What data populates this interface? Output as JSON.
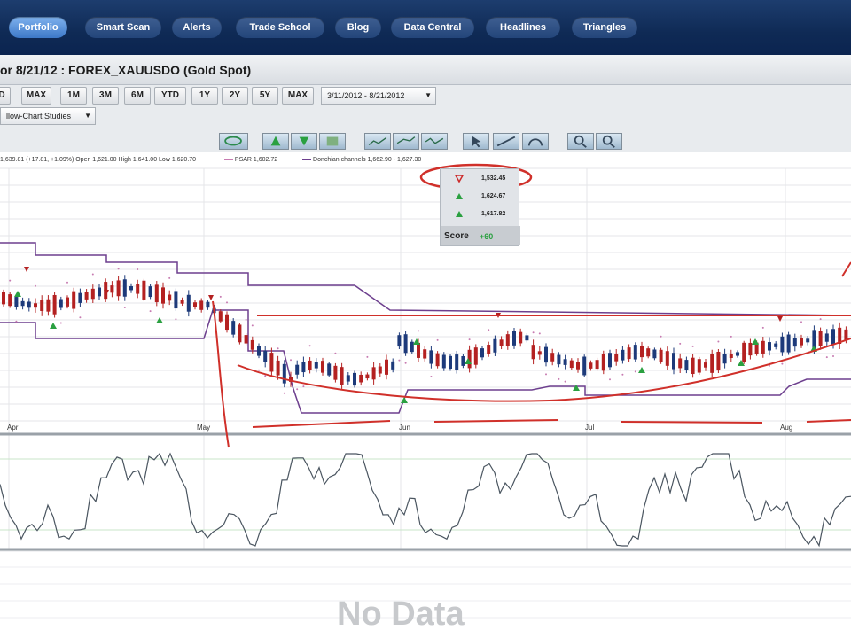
{
  "nav": {
    "items": [
      {
        "label": "Portfolio",
        "active": true
      },
      {
        "label": "Smart Scan"
      },
      {
        "label": "Alerts"
      },
      {
        "label": "Trade School"
      },
      {
        "label": "Blog"
      },
      {
        "label": "Data Central"
      },
      {
        "label": "Headlines"
      },
      {
        "label": "Triangles"
      }
    ]
  },
  "header": {
    "title": "or 8/21/12 : FOREX_XAUUSDO (Gold Spot)"
  },
  "toolbar": {
    "ranges": [
      "D",
      "MAX",
      "1M",
      "3M",
      "6M",
      "YTD",
      "1Y",
      "2Y",
      "5Y",
      "MAX"
    ],
    "date_range": "3/11/2012 - 8/21/2012",
    "studies_select": "llow-Chart Studies"
  },
  "chart": {
    "legend_quote": "1,639.81 (+17.81, +1.09%)  Open 1,621.00  High 1,641.00  Low 1,620.70",
    "legend_psar": "PSAR 1,602.72",
    "legend_donchian": "Donchian channels 1,662.90 - 1,627.30",
    "signals": [
      {
        "icon": "sell-triangle-icon",
        "value": "1,532.45",
        "color": "#cc2a2a"
      },
      {
        "icon": "buy-triangle-icon",
        "value": "1,624.67",
        "color": "#2aa040"
      },
      {
        "icon": "buy-triangle-icon",
        "value": "1,617.82",
        "color": "#2aa040"
      }
    ],
    "score_label": "Score",
    "score_value": "+60",
    "months": [
      "Apr",
      "May",
      "Jun",
      "Jul",
      "Aug"
    ],
    "no_data": "No Data",
    "colors": {
      "donchian": "#6d3f8e",
      "up_candle": "#1d3a7a",
      "down_candle": "#b42121",
      "psar": "#c77bb1",
      "annotation": "#d0302a",
      "oscillator": "#4a5560"
    }
  }
}
